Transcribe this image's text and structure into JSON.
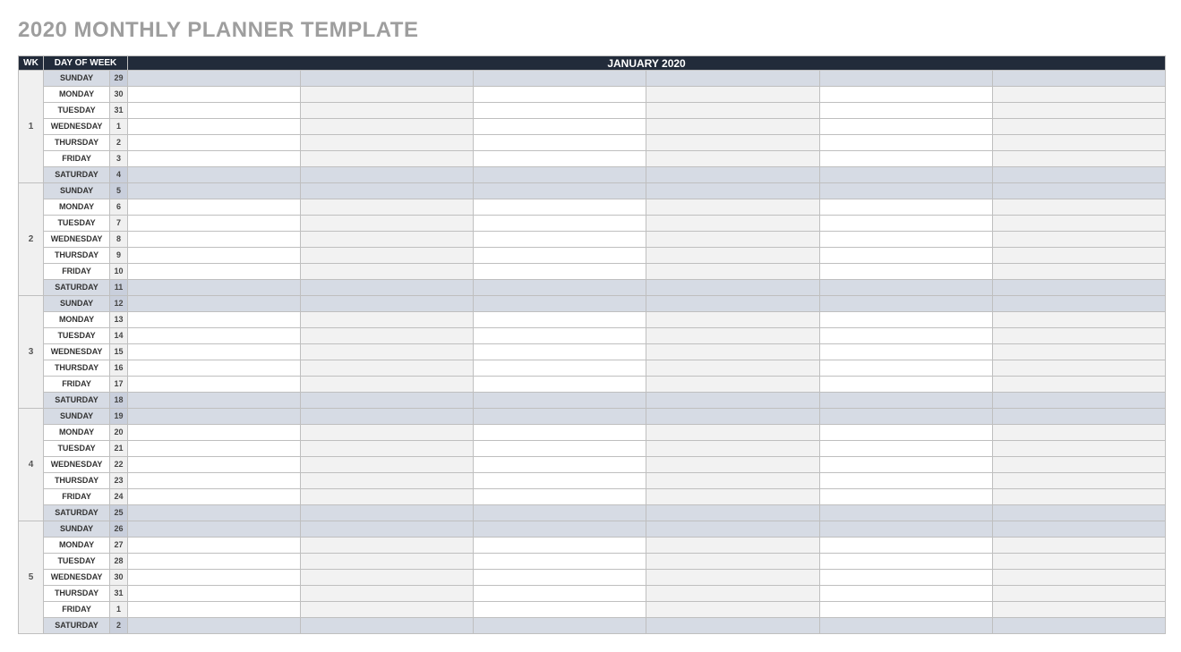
{
  "title": "2020 MONTHLY PLANNER TEMPLATE",
  "headers": {
    "wk": "WK",
    "dow": "DAY OF WEEK",
    "month": "JANUARY 2020"
  },
  "slot_columns": 6,
  "weeks": [
    {
      "wk": "1",
      "days": [
        {
          "dow": "SUNDAY",
          "date": "29",
          "weekend": true
        },
        {
          "dow": "MONDAY",
          "date": "30",
          "weekend": false
        },
        {
          "dow": "TUESDAY",
          "date": "31",
          "weekend": false
        },
        {
          "dow": "WEDNESDAY",
          "date": "1",
          "weekend": false
        },
        {
          "dow": "THURSDAY",
          "date": "2",
          "weekend": false
        },
        {
          "dow": "FRIDAY",
          "date": "3",
          "weekend": false
        },
        {
          "dow": "SATURDAY",
          "date": "4",
          "weekend": true
        }
      ]
    },
    {
      "wk": "2",
      "days": [
        {
          "dow": "SUNDAY",
          "date": "5",
          "weekend": true
        },
        {
          "dow": "MONDAY",
          "date": "6",
          "weekend": false
        },
        {
          "dow": "TUESDAY",
          "date": "7",
          "weekend": false
        },
        {
          "dow": "WEDNESDAY",
          "date": "8",
          "weekend": false
        },
        {
          "dow": "THURSDAY",
          "date": "9",
          "weekend": false
        },
        {
          "dow": "FRIDAY",
          "date": "10",
          "weekend": false
        },
        {
          "dow": "SATURDAY",
          "date": "11",
          "weekend": true
        }
      ]
    },
    {
      "wk": "3",
      "days": [
        {
          "dow": "SUNDAY",
          "date": "12",
          "weekend": true
        },
        {
          "dow": "MONDAY",
          "date": "13",
          "weekend": false
        },
        {
          "dow": "TUESDAY",
          "date": "14",
          "weekend": false
        },
        {
          "dow": "WEDNESDAY",
          "date": "15",
          "weekend": false
        },
        {
          "dow": "THURSDAY",
          "date": "16",
          "weekend": false
        },
        {
          "dow": "FRIDAY",
          "date": "17",
          "weekend": false
        },
        {
          "dow": "SATURDAY",
          "date": "18",
          "weekend": true
        }
      ]
    },
    {
      "wk": "4",
      "days": [
        {
          "dow": "SUNDAY",
          "date": "19",
          "weekend": true
        },
        {
          "dow": "MONDAY",
          "date": "20",
          "weekend": false
        },
        {
          "dow": "TUESDAY",
          "date": "21",
          "weekend": false
        },
        {
          "dow": "WEDNESDAY",
          "date": "22",
          "weekend": false
        },
        {
          "dow": "THURSDAY",
          "date": "23",
          "weekend": false
        },
        {
          "dow": "FRIDAY",
          "date": "24",
          "weekend": false
        },
        {
          "dow": "SATURDAY",
          "date": "25",
          "weekend": true
        }
      ]
    },
    {
      "wk": "5",
      "days": [
        {
          "dow": "SUNDAY",
          "date": "26",
          "weekend": true
        },
        {
          "dow": "MONDAY",
          "date": "27",
          "weekend": false
        },
        {
          "dow": "TUESDAY",
          "date": "28",
          "weekend": false
        },
        {
          "dow": "WEDNESDAY",
          "date": "30",
          "weekend": false
        },
        {
          "dow": "THURSDAY",
          "date": "31",
          "weekend": false
        },
        {
          "dow": "FRIDAY",
          "date": "1",
          "weekend": false
        },
        {
          "dow": "SATURDAY",
          "date": "2",
          "weekend": true
        }
      ]
    }
  ]
}
